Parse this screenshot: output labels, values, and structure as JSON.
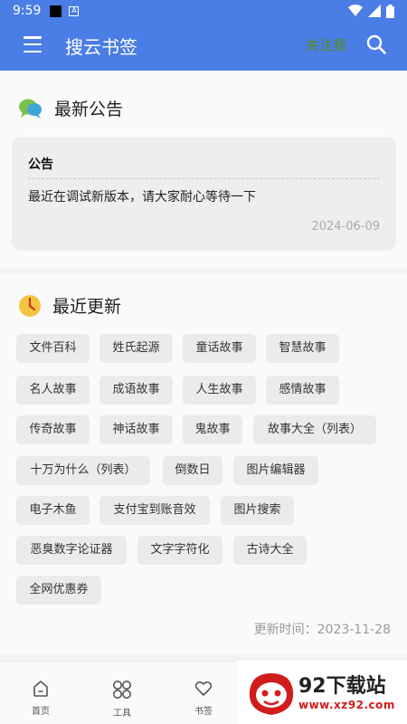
{
  "status_bar": {
    "time": "9:59"
  },
  "app_bar": {
    "title": "搜云书签",
    "follow_label": "关注我"
  },
  "notice_section": {
    "title": "最新公告",
    "card": {
      "title": "公告",
      "body": "最近在调试新版本，请大家耐心等待一下",
      "date": "2024-06-09"
    }
  },
  "updates_section": {
    "title": "最近更新",
    "tags": [
      "文件百科",
      "姓氏起源",
      "童话故事",
      "智慧故事",
      "名人故事",
      "成语故事",
      "人生故事",
      "感情故事",
      "传奇故事",
      "神话故事",
      "鬼故事",
      "故事大全（列表）",
      "十万为什么（列表）",
      "倒数日",
      "图片编辑器",
      "电子木鱼",
      "支付宝到账音效",
      "图片搜索",
      "恶臭数字论证器",
      "文字字符化",
      "古诗大全",
      "全网优惠券"
    ],
    "update_time": "更新时间：2023-11-28"
  },
  "bottom_nav": {
    "items": [
      {
        "label": "首页"
      },
      {
        "label": "工具"
      },
      {
        "label": "书签"
      }
    ]
  },
  "watermark": {
    "text": "92下载站",
    "url": "www.xz92.com"
  },
  "colors": {
    "primary": "#4a7de6",
    "follow": "#5a8a1a",
    "watermark_red": "#d01c1c"
  }
}
